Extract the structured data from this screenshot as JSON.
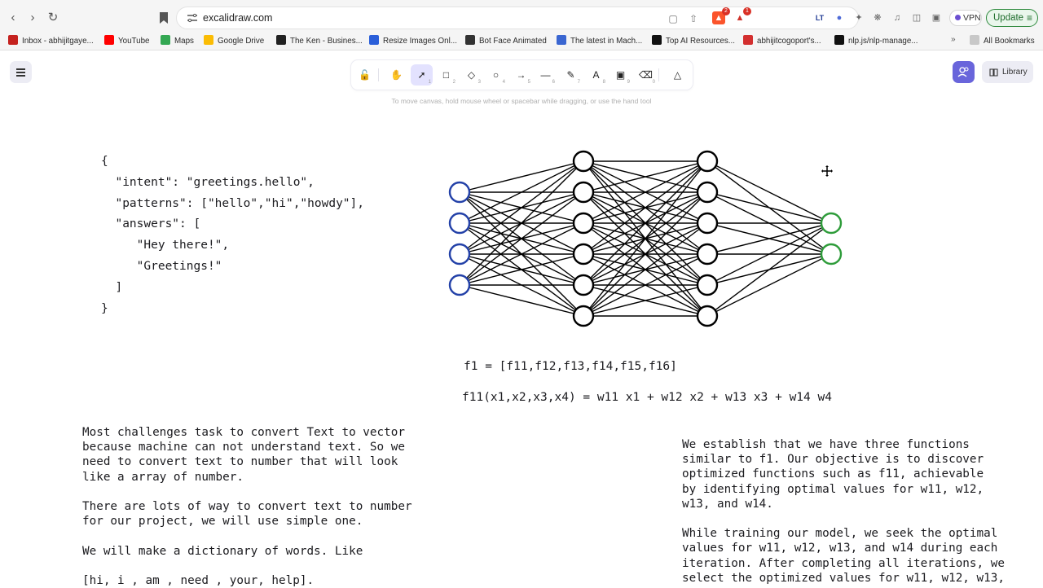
{
  "browser": {
    "url": "excalidraw.com",
    "vpn_label": "VPN",
    "update_label": "Update",
    "extension_badges": [
      "2",
      "1"
    ],
    "bookmarks": [
      {
        "label": "Inbox - abhijitgaye...",
        "icon": "gmail-icon",
        "color": "#c5221f"
      },
      {
        "label": "YouTube",
        "icon": "youtube-icon",
        "color": "#ff0000"
      },
      {
        "label": "Maps",
        "icon": "maps-pin-icon",
        "color": "#34a853"
      },
      {
        "label": "Google Drive",
        "icon": "google-drive-icon",
        "color": "#fbbc04"
      },
      {
        "label": "The Ken - Busines...",
        "icon": "the-ken-icon",
        "color": "#222222"
      },
      {
        "label": "Resize Images Onl...",
        "icon": "resize-images-icon",
        "color": "#2b5fd9"
      },
      {
        "label": "Bot Face Animated",
        "icon": "bot-face-icon",
        "color": "#333333"
      },
      {
        "label": "The latest in Mach...",
        "icon": "papers-icon",
        "color": "#3a66d1"
      },
      {
        "label": "Top AI Resources...",
        "icon": "ai-resources-icon",
        "color": "#111111"
      },
      {
        "label": "abhijitcogoport's...",
        "icon": "medium-icon",
        "color": "#d32f2f"
      },
      {
        "label": "nlp.js/nlp-manage...",
        "icon": "github-icon",
        "color": "#111111"
      }
    ],
    "bookmarks_overflow": "»",
    "all_bookmarks_label": "All Bookmarks"
  },
  "excalidraw": {
    "toolbar_tools": [
      {
        "name": "lock",
        "key": ""
      },
      {
        "name": "hand",
        "key": ""
      },
      {
        "name": "selection",
        "key": "1"
      },
      {
        "name": "rectangle",
        "key": "2"
      },
      {
        "name": "diamond",
        "key": "3"
      },
      {
        "name": "ellipse",
        "key": "4"
      },
      {
        "name": "arrow",
        "key": "5"
      },
      {
        "name": "line",
        "key": "6"
      },
      {
        "name": "draw",
        "key": "7"
      },
      {
        "name": "text",
        "key": "8"
      },
      {
        "name": "image",
        "key": "9"
      },
      {
        "name": "eraser",
        "key": "0"
      },
      {
        "name": "extra-tools",
        "key": ""
      }
    ],
    "active_tool": "selection",
    "hint": "To move canvas, hold mouse wheel or spacebar while dragging, or use the hand tool",
    "library_label": "Library"
  },
  "canvas": {
    "json_block": "{\n  \"intent\": \"greetings.hello\",\n  \"patterns\": [\"hello\",\"hi\",\"howdy\"],\n  \"answers\": [\n     \"Hey there!\",\n     \"Greetings!\"\n  ]\n}",
    "formula_1": "f1 = [f11,f12,f13,f14,f15,f16]",
    "formula_2": "f11(x1,x2,x3,x4) = w11 x1 + w12 x2 + w13 x3 + w14 w4",
    "left_text": "Most challenges task to convert Text to vector\nbecause machine can not understand text. So we\nneed to convert text to number that will look\nlike a array of number.\n\nThere are lots of way to convert text to number\nfor our project, we will use simple one.\n\nWe will make a dictionary of words. Like\n\n[hi, i , am , need , your, help].",
    "right_text": "We establish that we have three functions\nsimilar to f1. Our objective is to discover\noptimized functions such as f11, achievable\nby identifying optimal values for w11, w12,\nw13, and w14.\n\nWhile training our model, we seek the optimal\nvalues for w11, w12, w13, and w14 during each\niteration. After completing all iterations, we\nselect the optimized values for w11, w12, w13,",
    "network": {
      "layer_sizes": [
        4,
        6,
        6,
        2
      ],
      "node_colors": [
        "#2341a8",
        "#000000",
        "#000000",
        "#2e9c3a"
      ],
      "edge_color": "#000000"
    }
  }
}
